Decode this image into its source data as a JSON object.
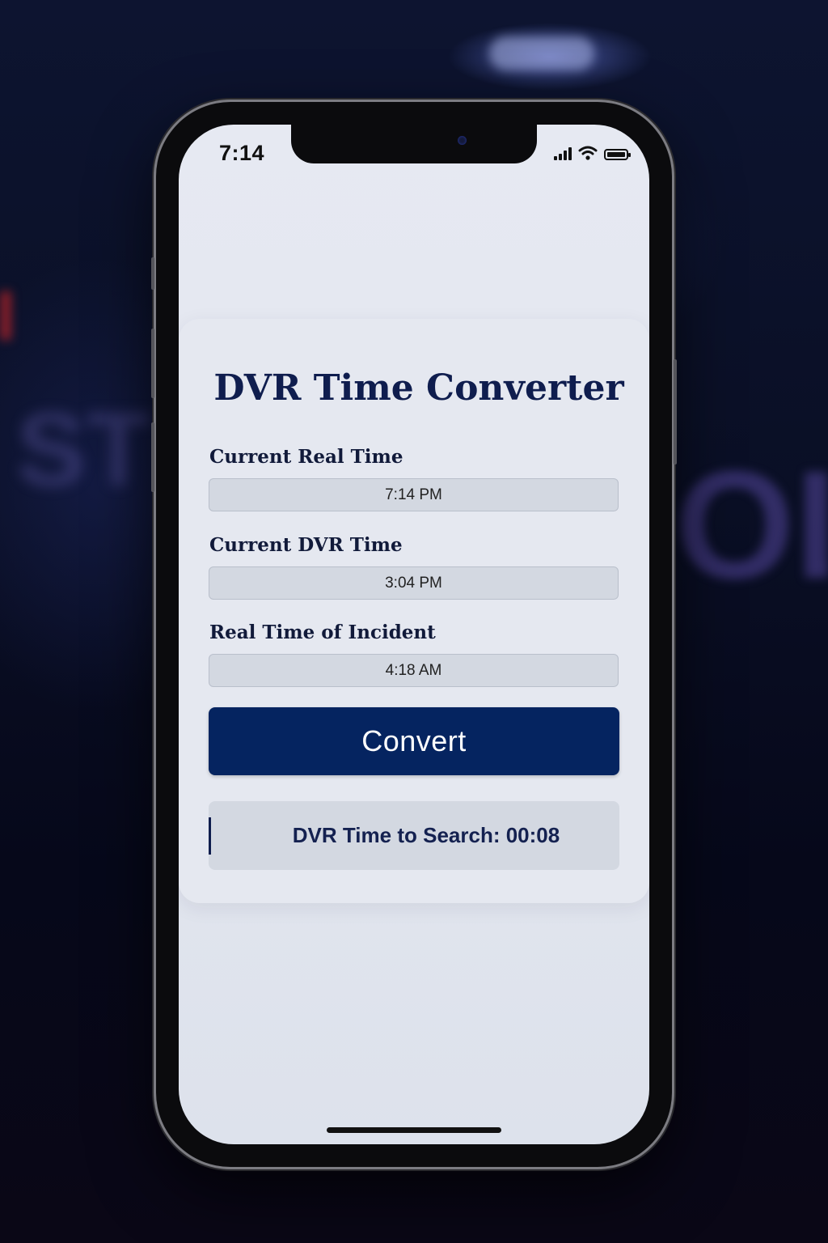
{
  "status_bar": {
    "time": "7:14"
  },
  "app": {
    "title": "DVR Time Converter",
    "fields": [
      {
        "label": "Current Real Time",
        "value": "7:14 PM"
      },
      {
        "label": "Current DVR Time",
        "value": "3:04 PM"
      },
      {
        "label": "Real Time of Incident",
        "value": "4:18 AM"
      }
    ],
    "convert_label": "Convert",
    "result_text": "DVR Time to Search: 00:08"
  },
  "background": {
    "blurred_text_left": "ST",
    "blurred_text_right": "OLI"
  },
  "icons": [
    "signal-icon",
    "wifi-icon",
    "battery-icon"
  ],
  "colors": {
    "accent": "#052460",
    "title": "#0f1d4e",
    "field_bg": "#d3d8e1",
    "card_bg": "#e5e8f0"
  }
}
